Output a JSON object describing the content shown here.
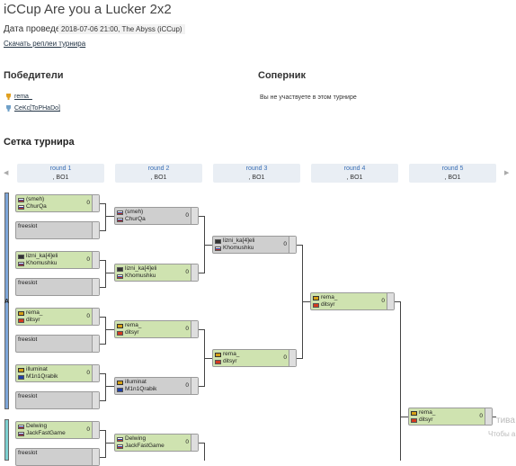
{
  "title": "iCCup Are you a Lucker 2x2",
  "date_label": "Дата проведения:",
  "date_value": "2018-07-06 21:00, The Abyss (iCCup)",
  "replays_link": "Скачать реплеи турнира",
  "winners_heading": "Победители",
  "winners": [
    {
      "name": "rema_",
      "icon": "gold-cup-icon"
    },
    {
      "name": "CeKc[ToPHaDo]",
      "icon": "silver-cup-icon"
    }
  ],
  "opponent_heading": "Соперник",
  "opponent_text": "Вы не участвуете в этом турнире",
  "bracket_heading": "Сетка турнира",
  "rounds": [
    {
      "name": "round 1",
      "bo": ", BO1"
    },
    {
      "name": "round 2",
      "bo": ", BO1"
    },
    {
      "name": "round 3",
      "bo": ", BO1"
    },
    {
      "name": "round 4",
      "bo": ", BO1"
    },
    {
      "name": "round 5",
      "bo": ", BO1"
    }
  ],
  "seed_label": "A",
  "matches": {
    "r1": [
      {
        "p1": "(smeh)",
        "p2": "ChurQa",
        "score": "0",
        "state": "green",
        "f1": "ru",
        "f2": "ru"
      },
      {
        "p1": "freeslot",
        "p2": "",
        "score": "",
        "state": "gray"
      },
      {
        "p1": "lizni_ka[4]eli",
        "p2": "Khomushku",
        "score": "0",
        "state": "green",
        "f1": "ban",
        "f2": "ru"
      },
      {
        "p1": "freeslot",
        "p2": "",
        "score": "",
        "state": "gray"
      },
      {
        "p1": "rema_",
        "p2": "ditsyr",
        "score": "0",
        "state": "green",
        "f1": "cup2",
        "f2": "ch"
      },
      {
        "p1": "freeslot",
        "p2": "",
        "score": "",
        "state": "gray"
      },
      {
        "p1": "illuminat",
        "p2": "M1n1Qrabik",
        "score": "0",
        "state": "green",
        "f1": "cup2",
        "f2": "eu"
      },
      {
        "p1": "freeslot",
        "p2": "",
        "score": "",
        "state": "gray"
      },
      {
        "p1": "Delwing",
        "p2": "JackFastGame",
        "score": "0",
        "state": "green",
        "f1": "ru",
        "f2": "ru"
      },
      {
        "p1": "freeslot",
        "p2": "",
        "score": "",
        "state": "gray"
      }
    ],
    "r2": [
      {
        "p1": "(smeh)",
        "p2": "ChurQa",
        "score": "0",
        "state": "gray",
        "f1": "ru",
        "f2": "ru"
      },
      {
        "p1": "lizni_ka[4]eli",
        "p2": "Khomushku",
        "score": "0",
        "state": "green",
        "f1": "ban",
        "f2": "ru"
      },
      {
        "p1": "rema_",
        "p2": "ditsyr",
        "score": "0",
        "state": "green",
        "f1": "cup2",
        "f2": "ch"
      },
      {
        "p1": "illuminat",
        "p2": "M1n1Qrabik",
        "score": "0",
        "state": "gray",
        "f1": "cup2",
        "f2": "eu"
      },
      {
        "p1": "Delwing",
        "p2": "JackFastGame",
        "score": "0",
        "state": "green",
        "f1": "ru",
        "f2": "ru"
      }
    ],
    "r3": [
      {
        "p1": "lizni_ka[4]eli",
        "p2": "Khomushku",
        "score": "0",
        "state": "gray",
        "f1": "ban",
        "f2": "ru"
      },
      {
        "p1": "rema_",
        "p2": "ditsyr",
        "score": "0",
        "state": "green",
        "f1": "cup2",
        "f2": "ch"
      }
    ],
    "r4": [
      {
        "p1": "rema_",
        "p2": "ditsyr",
        "score": "0",
        "state": "green",
        "f1": "cup2",
        "f2": "ch"
      }
    ],
    "r5": [
      {
        "p1": "rema_",
        "p2": "ditsyr",
        "score": "0",
        "state": "green",
        "f1": "cup2",
        "f2": "ch"
      }
    ]
  },
  "watermark": "тива",
  "watermark2": "Чтобы а"
}
